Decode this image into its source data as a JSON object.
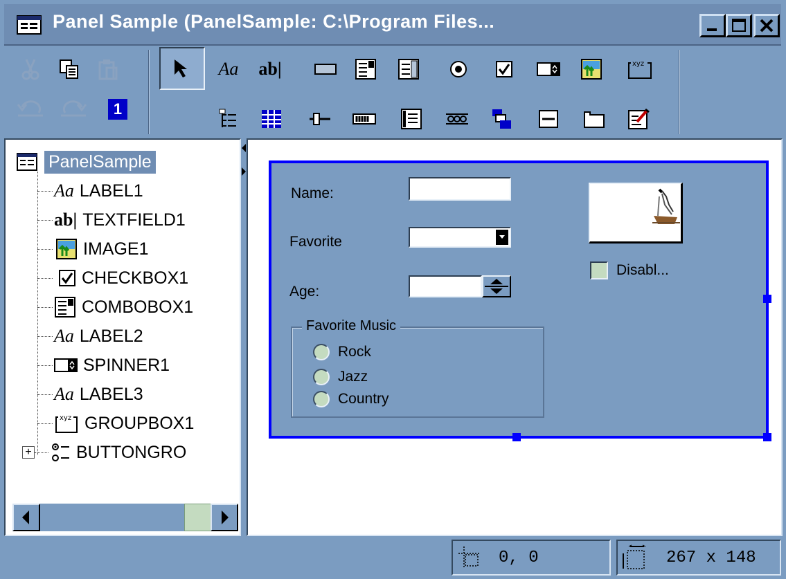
{
  "window": {
    "title": "Panel Sample (PanelSample: C:\\Program Files...",
    "controls": [
      "minimize-icon",
      "maximize-icon",
      "close-icon"
    ]
  },
  "toolbar": {
    "edit_tools": [
      "cut-icon",
      "copy-icon",
      "paste-icon",
      "undo-icon",
      "redo-icon",
      "tab-order-icon"
    ],
    "tab_order_label": "1",
    "component_row1": [
      "pointer-icon",
      "label-tool-icon",
      "textfield-tool-icon",
      "button-tool-icon",
      "combobox-tool-icon",
      "list-tool-icon",
      "radio-tool-icon",
      "checkbox-tool-icon",
      "spinner-tool-icon",
      "image-tool-icon",
      "groupbox-tool-icon"
    ],
    "component_row2": [
      "tree-tool-icon",
      "table-tool-icon",
      "slider-tool-icon",
      "progress-tool-icon",
      "textarea-tool-icon",
      "buttongroup-tool-icon",
      "menu-tool-icon",
      "toolbar-tool-icon",
      "tabbed-pane-tool-icon",
      "edit-properties-icon"
    ]
  },
  "tree": {
    "root": "PanelSample",
    "items": [
      {
        "label": "LABEL1",
        "icon": "label-icon"
      },
      {
        "label": "TEXTFIELD1",
        "icon": "textfield-icon"
      },
      {
        "label": "IMAGE1",
        "icon": "image-icon"
      },
      {
        "label": "CHECKBOX1",
        "icon": "checkbox-icon"
      },
      {
        "label": "COMBOBOX1",
        "icon": "combobox-icon"
      },
      {
        "label": "LABEL2",
        "icon": "label-icon"
      },
      {
        "label": "SPINNER1",
        "icon": "spinner-icon"
      },
      {
        "label": "LABEL3",
        "icon": "label-icon"
      },
      {
        "label": "GROUPBOX1",
        "icon": "groupbox-icon"
      },
      {
        "label": "BUTTONGRO",
        "icon": "buttongroup-icon"
      }
    ],
    "label_glyph": "Aa",
    "textfield_glyph": "ab|"
  },
  "form": {
    "name_label": "Name:",
    "name_value": "",
    "favorite_label": "Favorite",
    "favorite_value": "",
    "age_label": "Age:",
    "age_value": "",
    "checkbox_label": "Disabl...",
    "checkbox_checked": false,
    "group_title": "Favorite Music",
    "radios": [
      "Rock",
      "Jazz",
      "Country"
    ]
  },
  "status": {
    "position": "0, 0",
    "size": "267 x 148"
  },
  "colors": {
    "background": "#7b9cc1",
    "titlebar": "#6f8db3",
    "selection": "#0000ff"
  }
}
